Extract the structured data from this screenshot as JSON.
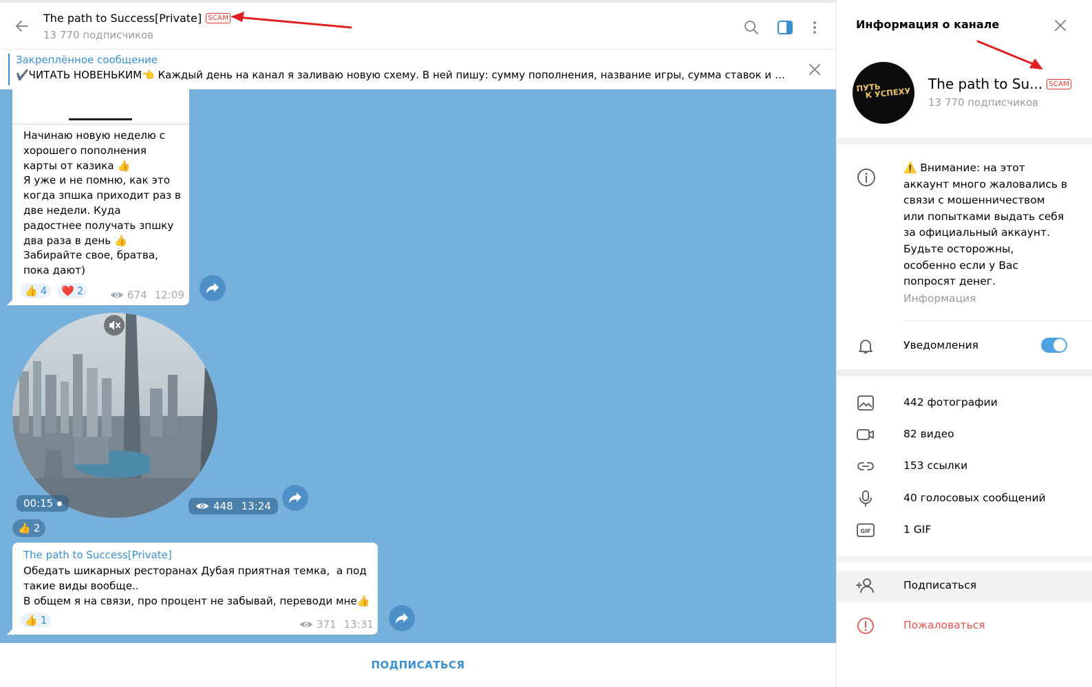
{
  "header": {
    "title": "The path to Success[Private]",
    "scam_badge": "SCAM",
    "subscribers": "13 770 подписчиков",
    "icons": [
      "back-arrow-icon",
      "search-icon",
      "sidebar-toggle-icon",
      "more-vertical-icon"
    ]
  },
  "pinned": {
    "title": "Закреплённое сообщение",
    "text": "✔️ЧИТАТЬ НОВЕНЬКИМ👈 Каждый день на канал я заливаю новую схему. В ней пишу: сумму пополнения, название игры, сумма ставок и ко..."
  },
  "messages": {
    "m1": {
      "text": "Начинаю новую неделю с хорошего пополнения карты от казика 👍\nЯ уже и не помню, как это когда зпшка приходит раз в две недели. Куда радостнее получать зпшку два раза в день 👍\nЗабирайте свое, братва, пока дают)",
      "reactions": [
        {
          "emoji": "👍",
          "count": "4"
        },
        {
          "emoji": "❤️",
          "count": "2"
        }
      ],
      "views": "674",
      "time": "12:09"
    },
    "m2": {
      "duration": "00:15",
      "views": "448",
      "time": "13:24",
      "reaction": {
        "emoji": "👍",
        "count": "2"
      }
    },
    "m3": {
      "author": "The path to Success[Private]",
      "text": "Обедать шикарных ресторанах Дубая приятная темка,  а под такие виды вообще..\nВ общем я на связи, про процент не забывай, переводи мне👍",
      "reaction": {
        "emoji": "👍",
        "count": "1"
      },
      "views": "371",
      "time": "13:31"
    }
  },
  "bottom": {
    "subscribe": "ПОДПИСАТЬСЯ"
  },
  "sidebar": {
    "title": "Информация о канале",
    "name": "The path to Su...",
    "scam_badge": "SCAM",
    "subscribers": "13 770 подписчиков",
    "avatar_text_1": "ПУТЬ",
    "avatar_text_2": "К УСПЕХУ",
    "warning": "⚠️ Внимание: на этот аккаунт много жаловались в связи с мошенничеством или попытками выдать себя за официальный аккаунт. Будьте осторожны, особенно если у Вас попросят денег.",
    "warning_label": "Информация",
    "notifications": "Уведомления",
    "notifications_on": true,
    "media": [
      {
        "icon": "photo-icon",
        "label": "442 фотографии"
      },
      {
        "icon": "video-icon",
        "label": "82 видео"
      },
      {
        "icon": "link-icon",
        "label": "153 ссылки"
      },
      {
        "icon": "microphone-icon",
        "label": "40 голосовых сообщений"
      },
      {
        "icon": "gif-icon",
        "label": "1 GIF"
      }
    ],
    "subscribe": "Подписаться",
    "report": "Пожаловаться"
  },
  "colors": {
    "accent": "#3a8fd0",
    "chat_bg": "#76b0dc",
    "scam": "#e53935",
    "arrow": "#e02020"
  }
}
